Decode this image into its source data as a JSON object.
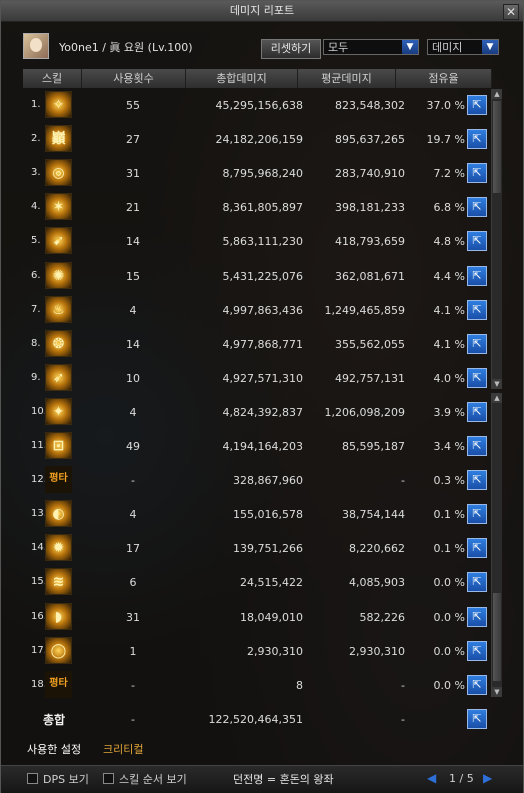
{
  "window": {
    "title": "데미지 리포트",
    "close": "✕"
  },
  "header": {
    "character": "Yo0ne1  /  眞 요원 (Lv.100)",
    "reset_label": "리셋하기",
    "filter_select": "모두",
    "sort_select": "데미지"
  },
  "columns": [
    "스킬",
    "사용횟수",
    "총합데미지",
    "평균데미지",
    "점유율"
  ],
  "icons": {
    "share": "share-icon",
    "dropdown": "chevron-down-icon",
    "close": "close-icon",
    "prev": "prev-page-icon",
    "next": "next-page-icon"
  },
  "rows": [
    {
      "rank": "1.",
      "icon": "✧",
      "count": "55",
      "total": "45,295,156,638",
      "avg": "823,548,302",
      "share": "37.0 %"
    },
    {
      "rank": "2.",
      "icon": "巓",
      "count": "27",
      "total": "24,182,206,159",
      "avg": "895,637,265",
      "share": "19.7 %"
    },
    {
      "rank": "3.",
      "icon": "◎",
      "count": "31",
      "total": "8,795,968,240",
      "avg": "283,740,910",
      "share": "7.2 %"
    },
    {
      "rank": "4.",
      "icon": "✶",
      "count": "21",
      "total": "8,361,805,897",
      "avg": "398,181,233",
      "share": "6.8 %"
    },
    {
      "rank": "5.",
      "icon": "➹",
      "count": "14",
      "total": "5,863,111,230",
      "avg": "418,793,659",
      "share": "4.8 %"
    },
    {
      "rank": "6.",
      "icon": "✺",
      "count": "15",
      "total": "5,431,225,076",
      "avg": "362,081,671",
      "share": "4.4 %"
    },
    {
      "rank": "7.",
      "icon": "♨",
      "count": "4",
      "total": "4,997,863,436",
      "avg": "1,249,465,859",
      "share": "4.1 %"
    },
    {
      "rank": "8.",
      "icon": "❂",
      "count": "14",
      "total": "4,977,868,771",
      "avg": "355,562,055",
      "share": "4.1 %"
    },
    {
      "rank": "9.",
      "icon": "➶",
      "count": "10",
      "total": "4,927,571,310",
      "avg": "492,757,131",
      "share": "4.0 %"
    },
    {
      "rank": "10.",
      "icon": "✦",
      "count": "4",
      "total": "4,824,392,837",
      "avg": "1,206,098,209",
      "share": "3.9 %"
    },
    {
      "rank": "11.",
      "icon": "⊡",
      "count": "49",
      "total": "4,194,164,203",
      "avg": "85,595,187",
      "share": "3.4 %"
    },
    {
      "rank": "12.",
      "icon": "평타",
      "count": "-",
      "total": "328,867,960",
      "avg": "-",
      "share": "0.3 %"
    },
    {
      "rank": "13.",
      "icon": "◐",
      "count": "4",
      "total": "155,016,578",
      "avg": "38,754,144",
      "share": "0.1 %"
    },
    {
      "rank": "14.",
      "icon": "✹",
      "count": "17",
      "total": "139,751,266",
      "avg": "8,220,662",
      "share": "0.1 %"
    },
    {
      "rank": "15.",
      "icon": "≋",
      "count": "6",
      "total": "24,515,422",
      "avg": "4,085,903",
      "share": "0.0 %"
    },
    {
      "rank": "16.",
      "icon": "◗",
      "count": "31",
      "total": "18,049,010",
      "avg": "582,226",
      "share": "0.0 %"
    },
    {
      "rank": "17.",
      "icon": "◯",
      "count": "1",
      "total": "2,930,310",
      "avg": "2,930,310",
      "share": "0.0 %"
    },
    {
      "rank": "18.",
      "icon": "평타",
      "count": "-",
      "total": "8",
      "avg": "-",
      "share": "0.0 %"
    }
  ],
  "total": {
    "label": "총합",
    "count": "-",
    "total": "122,520,464,351",
    "avg": "-"
  },
  "tabs": {
    "used_settings": "사용한 설정",
    "critical": "크리티컬"
  },
  "bottom": {
    "dps_label": "DPS 보기",
    "order_label": "스킬 순서 보기",
    "dungeon": "던전명 = 혼돈의 왕좌",
    "page": "1 / 5"
  },
  "colors": {
    "accent_blue": "#2f7ee0",
    "tab_active": "#ffffff",
    "tab_inactive": "#e2a63a"
  }
}
